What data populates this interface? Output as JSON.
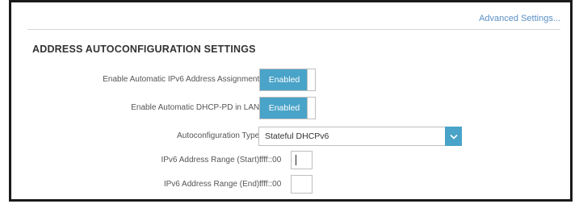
{
  "header": {
    "advanced_settings_link": "Advanced Settings..."
  },
  "section": {
    "title": "ADDRESS AUTOCONFIGURATION SETTINGS"
  },
  "fields": {
    "auto_ipv6_assignment": {
      "label": "Enable Automatic IPv6 Address Assignment:",
      "state": "Enabled"
    },
    "auto_dhcp_pd": {
      "label": "Enable Automatic DHCP-PD in LAN:",
      "state": "Enabled"
    },
    "autoconfig_type": {
      "label": "Autoconfiguration Type:",
      "selected": "Stateful DHCPv6"
    },
    "range_start": {
      "label": "IPv6 Address Range (Start):",
      "prefix": "ffff::00",
      "value": ""
    },
    "range_end": {
      "label": "IPv6 Address Range (End):",
      "prefix": "ffff::00",
      "value": ""
    }
  },
  "colors": {
    "accent": "#4aa3c8",
    "link": "#5a8fc4",
    "frame": "#1a1a1a"
  },
  "icons": {
    "dropdown": "chevron-down-icon"
  }
}
